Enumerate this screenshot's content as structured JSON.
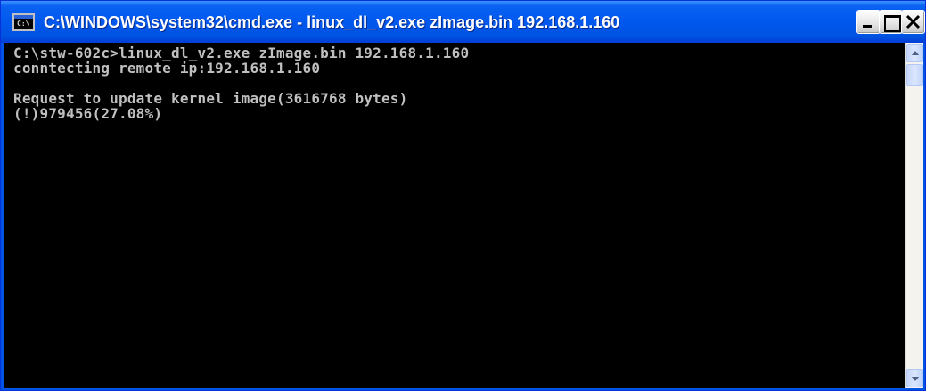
{
  "window": {
    "title": "C:\\WINDOWS\\system32\\cmd.exe - linux_dl_v2.exe zImage.bin 192.168.1.160",
    "app_icon": "cmd-prompt-icon",
    "app_icon_glyph": "C:\\",
    "buttons": {
      "minimize": "minimize-icon",
      "maximize": "maximize-icon",
      "close": "close-icon"
    }
  },
  "console": {
    "lines": [
      "C:\\stw-602c>linux_dl_v2.exe zImage.bin 192.168.1.160",
      "conntecting remote ip:192.168.1.160",
      "",
      "Request to update kernel image(3616768 bytes)",
      "(!)979456(27.08%)"
    ],
    "colors": {
      "background": "#000000",
      "text": "#c0c0c0"
    }
  },
  "scrollbar": {
    "up_icon": "scroll-up-arrow-icon",
    "down_icon": "scroll-down-arrow-icon"
  },
  "theme": {
    "titlebar_blue": "#0058ee",
    "title_text": "#ffffff"
  }
}
